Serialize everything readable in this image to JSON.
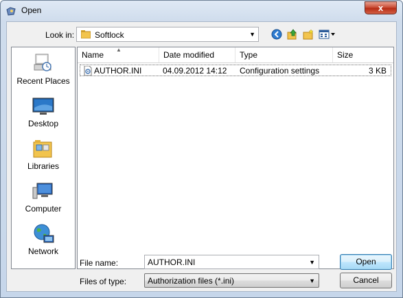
{
  "window": {
    "title": "Open",
    "close_label": "x"
  },
  "lookin": {
    "label": "Look in:",
    "value": "Softlock"
  },
  "places": [
    {
      "name": "recent-places",
      "label": "Recent Places"
    },
    {
      "name": "desktop",
      "label": "Desktop"
    },
    {
      "name": "libraries",
      "label": "Libraries"
    },
    {
      "name": "computer",
      "label": "Computer"
    },
    {
      "name": "network",
      "label": "Network"
    }
  ],
  "columns": {
    "name": "Name",
    "date": "Date modified",
    "type": "Type",
    "size": "Size"
  },
  "files": [
    {
      "name": "AUTHOR.INI",
      "date": "04.09.2012 14:12",
      "type": "Configuration settings",
      "size": "3 KB"
    }
  ],
  "filename": {
    "label": "File name:",
    "value": "AUTHOR.INI"
  },
  "filetype": {
    "label": "Files of type:",
    "value": "Authorization files (*.ini)"
  },
  "buttons": {
    "open": "Open",
    "cancel": "Cancel"
  },
  "colors": {
    "accent": "#3c7fb1",
    "selection_border": "#666666",
    "title_bg": "#dfe9f5"
  }
}
